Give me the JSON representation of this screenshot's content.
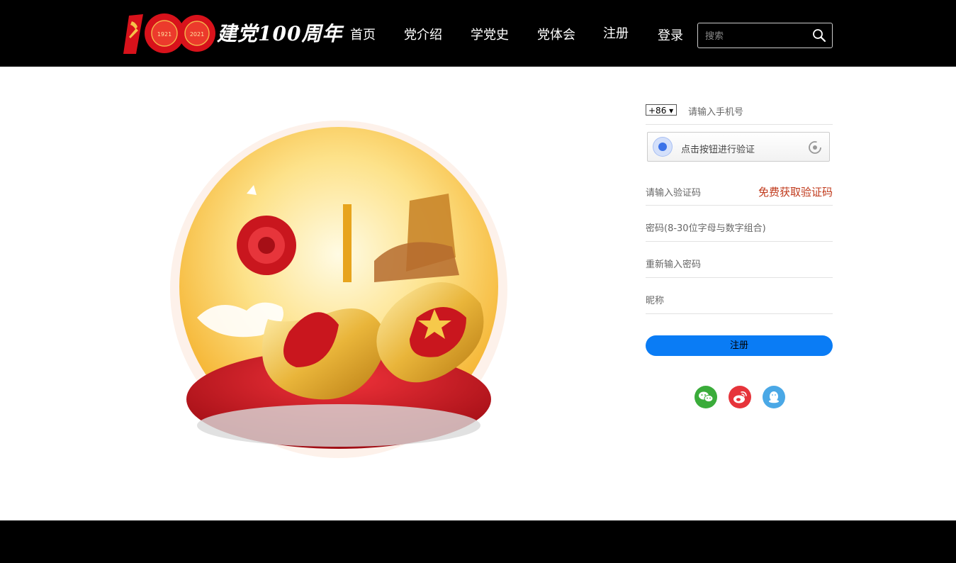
{
  "header": {
    "logo_number": "100",
    "logo_years": [
      "1921",
      "2021"
    ],
    "logo_text": "建党100周年",
    "nav": [
      {
        "label": "首页"
      },
      {
        "label": "党介绍"
      },
      {
        "label": "学党史"
      },
      {
        "label": "党体会"
      },
      {
        "label": "注册"
      },
      {
        "label": "登录"
      }
    ],
    "search": {
      "placeholder": "搜索",
      "icon": "search-icon"
    }
  },
  "hero": {
    "numeral": "100"
  },
  "form": {
    "country_code": "+86 ▾",
    "phone_placeholder": "请输入手机号",
    "captcha_text": "点击按钮进行验证",
    "code_placeholder": "请输入验证码",
    "get_code_label": "免费获取验证码",
    "password_placeholder": "密码(8-30位字母与数字组合)",
    "repeat_password_placeholder": "重新输入密码",
    "nickname_placeholder": "昵称",
    "submit_label": "注册"
  },
  "social": [
    {
      "icon": "wechat-icon",
      "color": "#3aac3a"
    },
    {
      "icon": "weibo-icon",
      "color": "#e6343b"
    },
    {
      "icon": "qq-icon",
      "color": "#4aa8e6"
    }
  ],
  "colors": {
    "accent": "#0a7cf5",
    "link_red": "#c0391b",
    "header_bg": "#000000"
  }
}
